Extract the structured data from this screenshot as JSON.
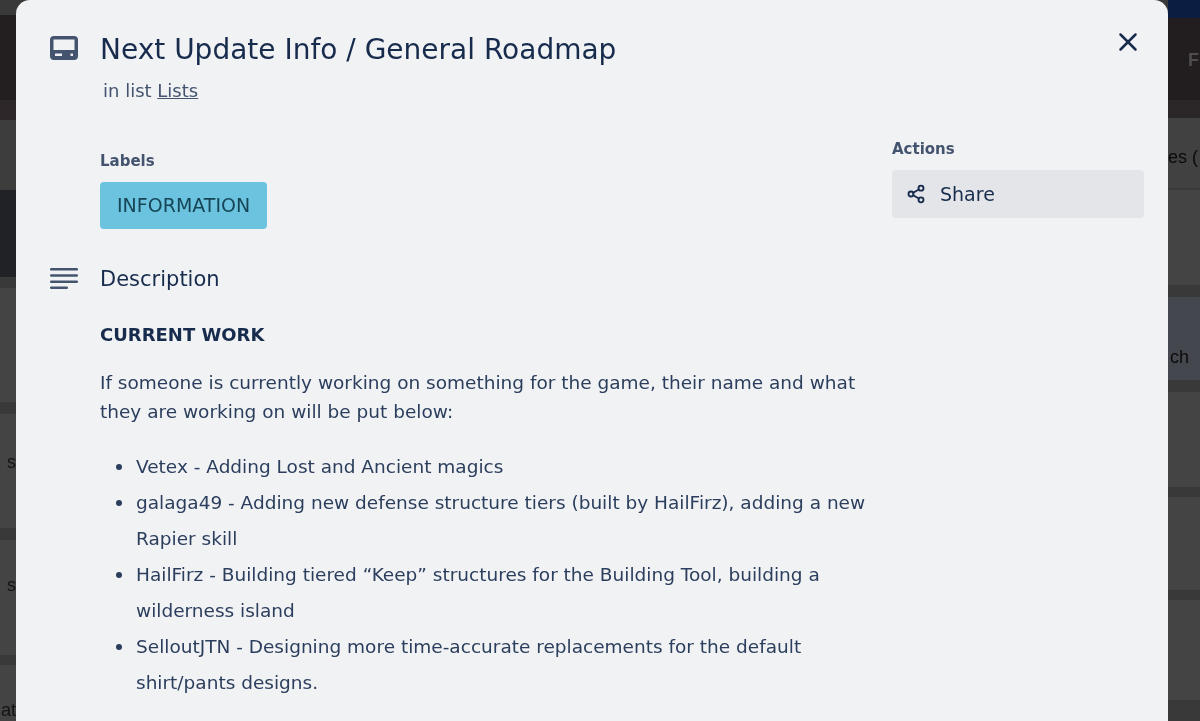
{
  "background_board": {
    "header_fragments": [
      "F"
    ],
    "left_fragments": [
      "s",
      "s",
      "at"
    ],
    "right_fragments": [
      "es (",
      "ch"
    ]
  },
  "card": {
    "title": "Next Update Info / General Roadmap",
    "list_prefix": "in list",
    "list_name": "Lists"
  },
  "labels_section": {
    "heading": "Labels",
    "labels": [
      {
        "text": "INFORMATION",
        "color": "#6cc3e0"
      }
    ]
  },
  "description": {
    "heading": "Description",
    "subheading": "CURRENT WORK",
    "paragraph": "If someone is currently working on something for the game, their name and what they are working on will be put below:",
    "items": [
      "Vetex - Adding Lost and Ancient magics",
      "galaga49 - Adding new defense structure tiers (built by HailFirz), adding a new Rapier skill",
      "HailFirz - Building tiered “Keep” structures for the Building Tool, building a wilderness island",
      "SelloutJTN - Designing more time-accurate replacements for the default shirt/pants designs."
    ]
  },
  "actions": {
    "heading": "Actions",
    "buttons": [
      {
        "label": "Share"
      }
    ]
  }
}
